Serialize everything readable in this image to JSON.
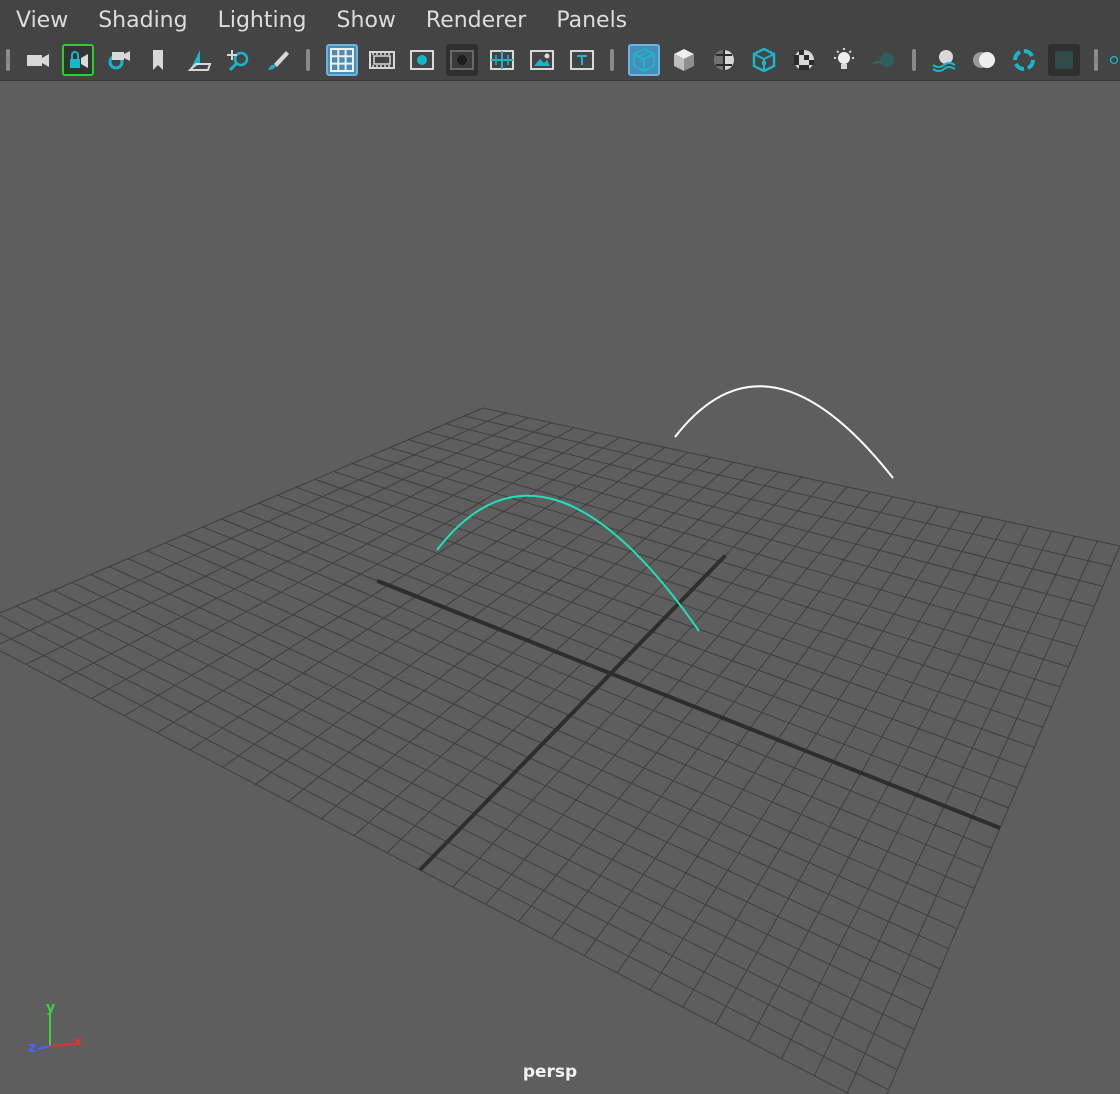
{
  "menu": [
    "View",
    "Shading",
    "Lighting",
    "Show",
    "Renderer",
    "Panels"
  ],
  "toolbar": {
    "icons": [
      "select-camera-icon",
      "lock-camera-icon",
      "camera-attributes-icon",
      "bookmark-icon",
      "image-plane-icon",
      "two-d-pan-zoom-icon",
      "grease-pencil-icon",
      "grid-icon",
      "film-gate-icon",
      "resolution-gate-icon",
      "gate-mask-icon",
      "field-chart-icon",
      "safe-action-icon",
      "safe-title-icon",
      "wireframe-icon",
      "smooth-shade-icon",
      "wireframe-on-shaded-icon",
      "textured-icon",
      "use-all-lights-icon",
      "shadows-icon",
      "screen-space-ao-icon",
      "motion-blur-icon",
      "anti-aliasing-icon",
      "depth-of-field-icon",
      "isolate-select-icon",
      "x-ray-icon"
    ],
    "active": [
      "grid-icon",
      "wireframe-icon"
    ]
  },
  "viewport": {
    "camera": "persp",
    "axis_labels": {
      "x": "x",
      "y": "y",
      "z": "z"
    },
    "colors": {
      "background": "#5e5e5e",
      "grid_line": "#3f3f3f",
      "grid_axis": "#2e2e2e",
      "selected_curve": "#1de2b3",
      "curve": "#ffffff",
      "axis_x": "#e03232",
      "axis_y": "#3cd23c",
      "axis_z": "#4a64ff"
    }
  }
}
